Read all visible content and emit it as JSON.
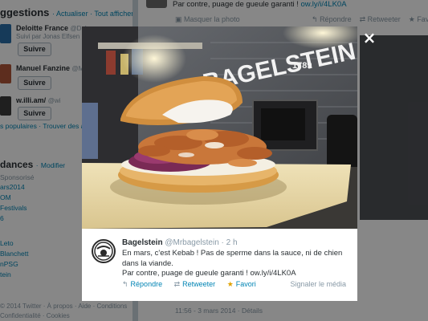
{
  "background": {
    "suggestions": {
      "title": "ggestions",
      "separator": "·",
      "refresh_label": "Actualiser",
      "view_all_label": "Tout afficher",
      "items": [
        {
          "name": "Deloitte France",
          "handle": "@Del",
          "via": "Suivi par Jonas Elfsen",
          "follow_label": "Suivre",
          "color": "#2a6fa8"
        },
        {
          "name": "Manuel Fanzine",
          "handle": "@Ma",
          "via": "",
          "follow_label": "Suivre",
          "color": "#b0563a"
        },
        {
          "name": "w.illi.am/",
          "handle": "@wi",
          "via": "",
          "follow_label": "Suivre",
          "color": "#3b3b3b"
        }
      ],
      "popular_label": "s populaires",
      "find_friends_label": "Trouver des amis"
    },
    "trends": {
      "title": "dances",
      "modify_label": "Modifier",
      "items": [
        {
          "label": "Sponsorisé",
          "promoted": true
        },
        {
          "label": "ars2014",
          "promoted": false
        },
        {
          "label": "OM",
          "promoted": false
        },
        {
          "label": "Festivals",
          "promoted": false
        },
        {
          "label": "6",
          "promoted": false
        },
        {
          "label": "Leto",
          "promoted": false
        },
        {
          "label": "Blanchett",
          "promoted": false
        },
        {
          "label": "nPSG",
          "promoted": false
        },
        {
          "label": "tein",
          "promoted": false
        }
      ]
    },
    "footer": {
      "line1": "© 2014 Twitter · À propos · Aide · Conditions",
      "line2": "Confidentialité · Cookies"
    },
    "top_tweet": {
      "text_prefix": "Par contre, puage de gueule garanti ! ",
      "link": "ow.ly/i/4LK0A",
      "hide_photo_label": "Masquer la photo",
      "reply_label": "Répondre",
      "retweet_label": "Retweeter",
      "favorite_label": "Favori"
    },
    "detail_date": "11:56 - 3 mars 2014 · Détails"
  },
  "lightbox": {
    "close_label": "×",
    "photo_alt": "Kebab Bagelstein",
    "photo_sign_text": "BAGELSTEIN",
    "photo_sign_year": "1789",
    "tweet": {
      "name": "Bagelstein",
      "handle": "@Mrbagelstein",
      "separator": "·",
      "time": "2 h",
      "lines": [
        "En mars, c'est Kebab ! Pas de sperme dans la sauce, ni de chien",
        "dans la viande.",
        "Par contre, puage de gueule garanti ! ow.ly/i/4LK0A"
      ],
      "reply_label": "Répondre",
      "retweet_label": "Retweeter",
      "favorite_label": "Favori",
      "report_label": "Signaler le média"
    }
  },
  "colors": {
    "link": "#0084b4",
    "meta": "#8899a6",
    "text": "#292f33",
    "star": "#e0a200"
  }
}
